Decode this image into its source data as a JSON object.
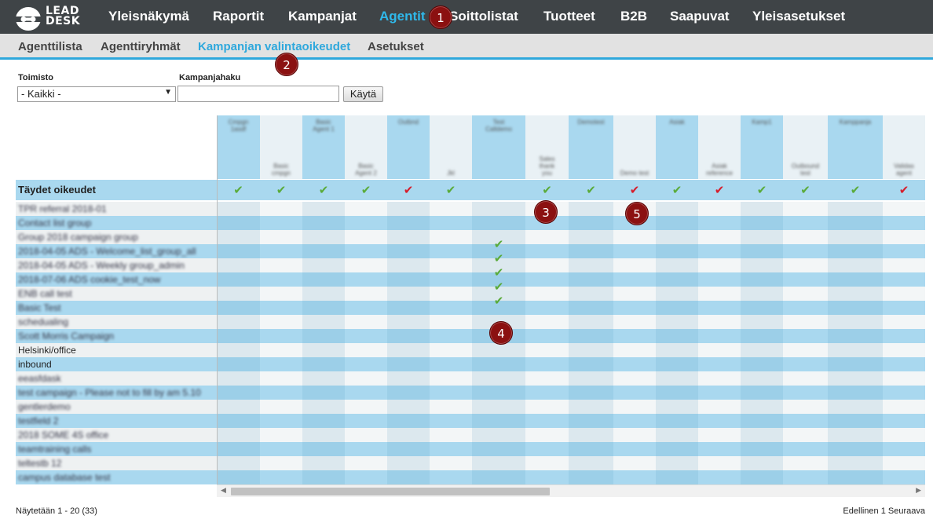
{
  "logo": {
    "line1": "LEAD",
    "line2": "DESK",
    "icon": "leaddesk-head-logo"
  },
  "topnav": {
    "items": [
      {
        "label": "Yleisnäkymä",
        "active": false
      },
      {
        "label": "Raportit",
        "active": false
      },
      {
        "label": "Kampanjat",
        "active": false
      },
      {
        "label": "Agentit",
        "active": true
      },
      {
        "label": "Soittolistat",
        "active": false
      },
      {
        "label": "Tuotteet",
        "active": false
      },
      {
        "label": "B2B",
        "active": false
      },
      {
        "label": "Saapuvat",
        "active": false
      },
      {
        "label": "Yleisasetukset",
        "active": false
      }
    ]
  },
  "subnav": {
    "items": [
      {
        "label": "Agenttilista",
        "active": false
      },
      {
        "label": "Agenttiryhmät",
        "active": false
      },
      {
        "label": "Kampanjan valintaoikeudet",
        "active": true
      },
      {
        "label": "Asetukset",
        "active": false
      }
    ]
  },
  "markers": [
    "1",
    "2",
    "3",
    "4",
    "5"
  ],
  "filters": {
    "office_label": "Toimisto",
    "office_value": "- Kaikki -",
    "campaign_label": "Kampanjahaku",
    "campaign_value": "",
    "apply_label": "Käytä"
  },
  "table": {
    "columns": [
      {
        "name": "Campaign A",
        "lines": [
          "Cmpgn",
          "1asdf"
        ],
        "valign": "top"
      },
      {
        "name": "Campaign B",
        "lines": [
          "Basic",
          "cmpgn"
        ],
        "valign": "bottom"
      },
      {
        "name": "Campaign C",
        "lines": [
          "Basic",
          "Agent 1"
        ],
        "valign": "top"
      },
      {
        "name": "Campaign D",
        "lines": [
          "Basic",
          "Agent 2"
        ],
        "valign": "bottom"
      },
      {
        "name": "Campaign E",
        "lines": [
          "Outbnd"
        ],
        "valign": "top"
      },
      {
        "name": "Campaign F",
        "lines": [
          "Jkl"
        ],
        "valign": "bottom"
      },
      {
        "name": "Campaign G",
        "lines": [
          "Test",
          "Calldemo"
        ],
        "valign": "top"
      },
      {
        "name": "Campaign H",
        "lines": [
          "Sales",
          "thank",
          "you"
        ],
        "valign": "bottom"
      },
      {
        "name": "Campaign I",
        "lines": [
          "Demotest"
        ],
        "valign": "top"
      },
      {
        "name": "Campaign J",
        "lines": [
          "Demo test"
        ],
        "valign": "bottom"
      },
      {
        "name": "Campaign K",
        "lines": [
          "Asiak"
        ],
        "valign": "top"
      },
      {
        "name": "Campaign L",
        "lines": [
          "Asiak",
          "reference"
        ],
        "valign": "bottom"
      },
      {
        "name": "Campaign M",
        "lines": [
          "Kamp1"
        ],
        "valign": "top"
      },
      {
        "name": "Campaign N",
        "lines": [
          "Outbound",
          "test"
        ],
        "valign": "bottom"
      },
      {
        "name": "Campaign O",
        "lines": [
          "Kamppanja"
        ],
        "valign": "top"
      },
      {
        "name": "Campaign P",
        "lines": [
          "Validas",
          "agent"
        ],
        "valign": "bottom"
      }
    ],
    "full_rights": {
      "label": "Täydet oikeudet",
      "checks": [
        "ok",
        "ok",
        "ok",
        "ok",
        "no",
        "ok",
        "",
        "ok",
        "ok",
        "no",
        "ok",
        "no",
        "ok",
        "ok",
        "ok",
        "no"
      ]
    },
    "rows": [
      {
        "label": "TPR referral 2018-01",
        "blur": true,
        "checks": {}
      },
      {
        "label": "Contact list group",
        "blur": true,
        "checks": {}
      },
      {
        "label": "Group 2018 campaign group",
        "blur": true,
        "checks": {}
      },
      {
        "label": "2018-04-05 ADS - Welcome_list_group_all",
        "blur": true,
        "checks": {
          "6": "ok"
        }
      },
      {
        "label": "2018-04-05 ADS - Weekly group_admin",
        "blur": true,
        "checks": {
          "6": "ok"
        }
      },
      {
        "label": "2018-07-06 ADS cookie_test_now",
        "blur": true,
        "checks": {
          "6": "ok"
        }
      },
      {
        "label": "ENB call test",
        "blur": true,
        "checks": {
          "6": "ok"
        }
      },
      {
        "label": "Basic Test",
        "blur": true,
        "checks": {
          "6": "ok"
        }
      },
      {
        "label": "schedualing",
        "blur": true,
        "checks": {}
      },
      {
        "label": "Scott Morris Campaign",
        "blur": true,
        "checks": {}
      },
      {
        "label": "Helsinki/office",
        "blur": false,
        "checks": {}
      },
      {
        "label": "inbound",
        "blur": false,
        "checks": {}
      },
      {
        "label": "eeasfdask",
        "blur": true,
        "checks": {}
      },
      {
        "label": "test campaign - Please not to fill by am 5.10",
        "blur": true,
        "checks": {}
      },
      {
        "label": "gentlerdemo",
        "blur": true,
        "checks": {}
      },
      {
        "label": "testfield 2",
        "blur": true,
        "checks": {}
      },
      {
        "label": "2018 SOME 4S office",
        "blur": true,
        "checks": {}
      },
      {
        "label": "teamtraining calls",
        "blur": true,
        "checks": {}
      },
      {
        "label": "teltestb 12",
        "blur": true,
        "checks": {}
      },
      {
        "label": "campus database test",
        "blur": true,
        "checks": {}
      }
    ]
  },
  "footer": {
    "showing": "Näytetään 1 - 20 (33)",
    "prev": "Edellinen",
    "page": "1",
    "next": "Seuraava"
  },
  "colors": {
    "topnav_bg": "#3f4447",
    "accent": "#2fb8ea",
    "row_blue": "#a9d8ef",
    "row_light": "#eef1f2",
    "check_ok": "#5aab3a",
    "check_no": "#d61d2b",
    "marker": "#8b1111"
  }
}
